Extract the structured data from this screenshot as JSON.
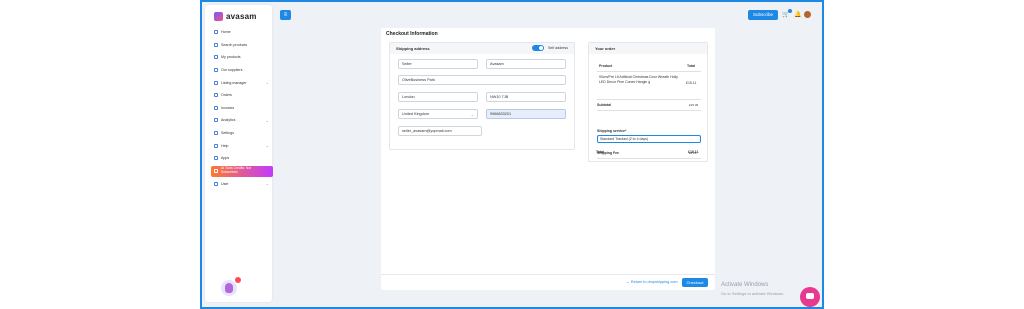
{
  "app": {
    "logo_text": "avasam"
  },
  "sidebar": {
    "items": [
      {
        "label": "Home",
        "icon": "home-icon"
      },
      {
        "label": "Search products",
        "icon": "search-icon"
      },
      {
        "label": "My products",
        "icon": "box-icon"
      },
      {
        "label": "Our suppliers",
        "icon": "suppliers-icon"
      },
      {
        "label": "Listing manager",
        "icon": "listing-icon",
        "chevron": true
      },
      {
        "label": "Orders",
        "icon": "orders-icon"
      },
      {
        "label": "Invoices",
        "icon": "invoice-icon"
      },
      {
        "label": "Analytics",
        "icon": "analytics-icon",
        "chevron": true
      },
      {
        "label": "Settings",
        "icon": "gear-icon"
      },
      {
        "label": "Help",
        "icon": "help-icon",
        "chevron": true
      },
      {
        "label": "Apps",
        "icon": "apps-icon"
      },
      {
        "label": "AI Tools Credits: Not Subscribed",
        "icon": "ai-icon",
        "promo": true
      },
      {
        "label": "User",
        "icon": "user-icon",
        "chevron": true
      }
    ]
  },
  "header": {
    "menu_icon": "≡",
    "subscribe_label": "Subscribe"
  },
  "checkout": {
    "title": "Checkout Information",
    "shipping": {
      "heading": "Shipping address",
      "self_address_label": "Self address",
      "self_address_on": true,
      "first_name": "Seller",
      "last_name": "Avasam",
      "address": "OliveBusiness Park",
      "city": "London",
      "postcode": "NW10 7JB",
      "country": "United Kingdom",
      "phone": "9966633201",
      "email": "seller_avasam@yopmail.com"
    },
    "order": {
      "heading": "Your order",
      "col_product": "Product",
      "col_total": "Total",
      "product_name": "90cm/Pre Lit Artificial Christmas Door Wreath Holly LED Decor Pine Cones Hangin g",
      "product_total": "£15.11",
      "subtotal_label": "Subtotal",
      "subtotal_value": "£15.36",
      "service_label": "Shipping service*",
      "service_value": "Standard Tracked (2 to 4 days)",
      "fee_label": "Shipping Fee",
      "fee_value": "£3.00",
      "total_label": "Total",
      "total_value": "£18.11"
    },
    "return_link": "← Return to dropshipping.com",
    "checkout_button": "Checkout"
  },
  "windows": {
    "activate_title": "Activate Windows",
    "activate_sub": "Go to Settings to activate Windows."
  },
  "colors": {
    "accent": "#1e88e5",
    "promo_start": "#ff7a2f",
    "promo_end": "#c13bff",
    "chat": "#e6398f"
  }
}
